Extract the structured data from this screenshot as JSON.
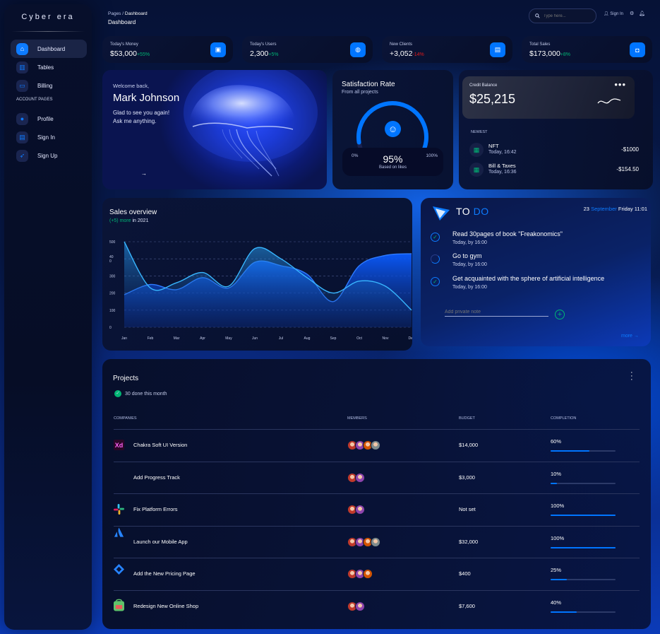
{
  "sidebar": {
    "brand": "Cyber era",
    "items": [
      {
        "label": "Dashboard",
        "icon": "home-icon",
        "glyph": "⌂"
      },
      {
        "label": "Tables",
        "icon": "chart-icon",
        "glyph": "▥"
      },
      {
        "label": "Billing",
        "icon": "card-icon",
        "glyph": "▭"
      },
      {
        "label": "Profile",
        "icon": "person-icon",
        "glyph": "●"
      },
      {
        "label": "Sign In",
        "icon": "document-icon",
        "glyph": "▤"
      },
      {
        "label": "Sign Up",
        "icon": "rocket-icon",
        "glyph": "➶"
      }
    ],
    "section_label": "ACCOUNT PAGES"
  },
  "header": {
    "breadcrumb_root": "Pages",
    "breadcrumb_sep": "/",
    "breadcrumb_current": "Dashboard",
    "title": "Dashboard",
    "search_placeholder": "Type here...",
    "sign_in": "Sign In"
  },
  "stats": [
    {
      "label": "Today's Money",
      "value": "$53,000",
      "change": "+55%",
      "trend": "up",
      "icon": "wallet-icon",
      "glyph": "▣"
    },
    {
      "label": "Today's Users",
      "value": "2,300",
      "change": "+5%",
      "trend": "up",
      "icon": "globe-icon",
      "glyph": "◍"
    },
    {
      "label": "New Clients",
      "value": "+3,052",
      "change": "-14%",
      "trend": "down",
      "icon": "document-icon",
      "glyph": "▤"
    },
    {
      "label": "Total Sales",
      "value": "$173,000",
      "change": "+8%",
      "trend": "up",
      "icon": "cart-icon",
      "glyph": "◘"
    }
  ],
  "welcome": {
    "greeting": "Welcome back,",
    "name": "Mark Johnson",
    "message_1": "Glad to see you again!",
    "message_2": "Ask me anything.",
    "arrow": "→"
  },
  "satisfaction": {
    "title": "Satisfaction Rate",
    "subtitle": "From all projects",
    "min_label": "0%",
    "max_label": "100%",
    "value_label": "95%",
    "value": 95,
    "caption": "Based on likes"
  },
  "credit": {
    "label": "Credit Balance",
    "balance": "$25,215",
    "menu": "•••",
    "newest_label": "NEWEST",
    "transactions": [
      {
        "name": "NFT",
        "date": "Today, 16:42",
        "amount": "-$1000"
      },
      {
        "name": "Bill & Taxes",
        "date": "Today, 16:36",
        "amount": "-$154.50"
      }
    ]
  },
  "sales": {
    "title": "Sales overview",
    "subtitle_highlight": "(+5) more",
    "subtitle_rest": "in 2021"
  },
  "chart_data": {
    "type": "area",
    "title": "Sales overview",
    "categories": [
      "Jan",
      "Feb",
      "Mar",
      "Apr",
      "May",
      "Jun",
      "Jul",
      "Aug",
      "Sep",
      "Oct",
      "Nov",
      "Dec"
    ],
    "y_tick_labels": [
      "0",
      "100",
      "200",
      "300",
      "40\n0",
      "500"
    ],
    "ylim": [
      0,
      500
    ],
    "grid": true,
    "series": [
      {
        "values": [
          500,
          230,
          260,
          320,
          240,
          460,
          400,
          290,
          200,
          270,
          240,
          100
        ]
      },
      {
        "values": [
          190,
          250,
          220,
          290,
          230,
          380,
          360,
          310,
          150,
          360,
          420,
          430
        ]
      }
    ]
  },
  "todo": {
    "title_main": "TO",
    "title_accent": "DO",
    "date_day": "23",
    "date_month": "September",
    "date_rest": "Friday 11:01",
    "tasks": [
      {
        "title": "Read 30pages of book \"Freakonomics\"",
        "time": "Today, by 16:00",
        "done": true
      },
      {
        "title": "Go to gym",
        "time": "Today, by 16:00",
        "done": false
      },
      {
        "title": "Get acquainted with the sphere of artificial intelligence",
        "time": "Today, by 16:00",
        "done": true
      }
    ],
    "note_placeholder": "Add private note",
    "more": "more →"
  },
  "projects": {
    "title": "Projects",
    "done_label": "30 done this month",
    "columns": [
      "COMPANIES",
      "MEMBERS",
      "BUDGET",
      "COMPLETION"
    ],
    "rows": [
      {
        "name": "Chakra Soft UI Version",
        "budget": "$14,000",
        "completion": "60%",
        "progress": 0.6,
        "members": 4,
        "logo": "xd-logo-icon",
        "logo_text": "Xd"
      },
      {
        "name": "Add Progress Track",
        "budget": "$3,000",
        "completion": "10%",
        "progress": 0.1,
        "members": 2,
        "logo": "blank-logo-icon",
        "logo_text": ""
      },
      {
        "name": "Fix Platform Errors",
        "budget": "Not set",
        "completion": "100%",
        "progress": 1.0,
        "members": 2,
        "logo": "slack-logo-icon",
        "logo_text": ""
      },
      {
        "name": "Launch our Mobile App",
        "budget": "$32,000",
        "completion": "100%",
        "progress": 1.0,
        "members": 4,
        "logo": "atlassian-logo-icon",
        "logo_text": ""
      },
      {
        "name": "Add the New Pricing Page",
        "budget": "$400",
        "completion": "25%",
        "progress": 0.25,
        "members": 3,
        "logo": "jira-logo-icon",
        "logo_text": ""
      },
      {
        "name": "Redesign New Online Shop",
        "budget": "$7,600",
        "completion": "40%",
        "progress": 0.4,
        "members": 2,
        "logo": "shop-logo-icon",
        "logo_text": ""
      }
    ]
  },
  "colors": {
    "accent": "#0075ff",
    "positive": "#01b574",
    "negative": "#e31a1a"
  }
}
